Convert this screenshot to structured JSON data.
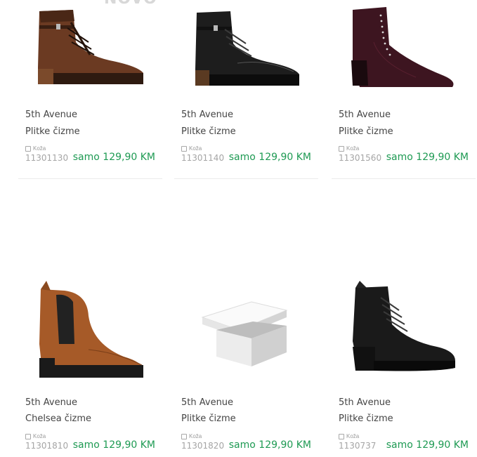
{
  "header": {
    "badge": "NOVO"
  },
  "products": [
    {
      "brand": "5th Avenue",
      "name": "Plitke čizme",
      "material": "Koža",
      "code": "11301130",
      "price": "samo 129,90 KM",
      "image": "brown-lace-up-boot"
    },
    {
      "brand": "5th Avenue",
      "name": "Plitke čizme",
      "material": "Koža",
      "code": "11301140",
      "price": "samo 129,90 KM",
      "image": "black-lace-up-boot"
    },
    {
      "brand": "5th Avenue",
      "name": "Plitke čizme",
      "material": "Koža",
      "code": "11301560",
      "price": "samo 129,90 KM",
      "image": "burgundy-studded-ankle-boot"
    },
    {
      "brand": "5th Avenue",
      "name": "Chelsea čizme",
      "material": "Koža",
      "code": "11301810",
      "price": "samo 129,90 KM",
      "image": "cognac-chelsea-boot"
    },
    {
      "brand": "5th Avenue",
      "name": "Plitke čizme",
      "material": "Koža",
      "code": "11301820",
      "price": "samo 129,90 KM",
      "image": "placeholder-shoe-box"
    },
    {
      "brand": "5th Avenue",
      "name": "Plitke čizme",
      "material": "Koža",
      "code": "1130737",
      "price": "samo 129,90 KM",
      "image": "black-heeled-lace-up-boot"
    }
  ],
  "colors": {
    "price": "#1e9a53",
    "text": "#444444",
    "muted": "#a5a5a5"
  }
}
